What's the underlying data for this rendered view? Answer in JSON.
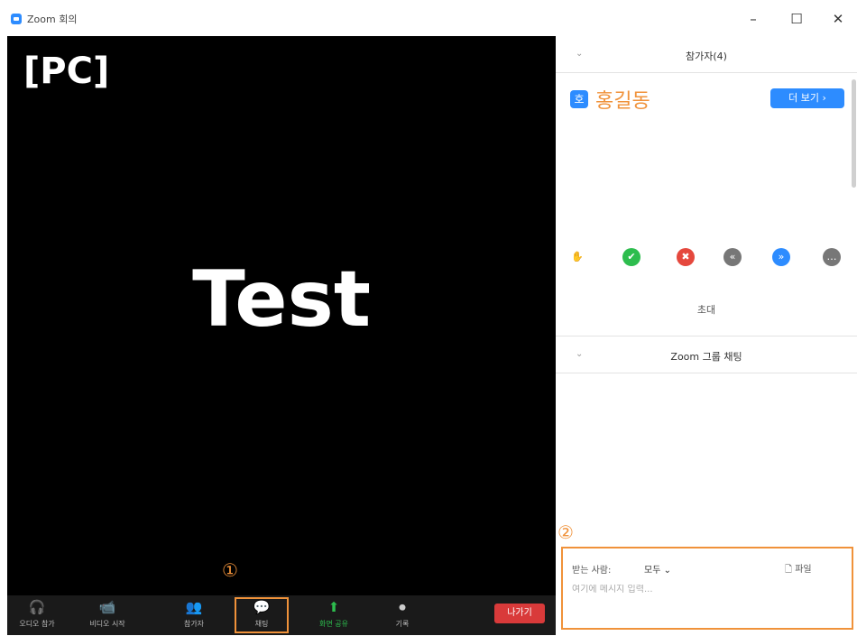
{
  "window": {
    "title": "Zoom 회의",
    "minimize": "–",
    "maximize": "☐",
    "close": "✕"
  },
  "video": {
    "corner_label": "[PC]",
    "participant_name": "Test"
  },
  "callouts": {
    "one": "①",
    "two": "②"
  },
  "toolbar": {
    "items": [
      {
        "icon": "headphones-icon",
        "glyph": "🎧",
        "label": "오디오 참가"
      },
      {
        "icon": "video-off-icon",
        "glyph": "📹",
        "label": "비디오 시작"
      },
      {
        "icon": "participants-icon",
        "glyph": "👥",
        "label": "참가자"
      },
      {
        "icon": "chat-icon",
        "glyph": "💬",
        "label": "채팅"
      },
      {
        "icon": "share-screen-icon",
        "glyph": "⬆",
        "label": "화면 공유"
      },
      {
        "icon": "record-icon",
        "glyph": "⏺",
        "label": "기록"
      }
    ],
    "leave_label": "나가기",
    "colors": {
      "share": "#2dbd4e",
      "leave": "#d93a3a"
    }
  },
  "participants_panel": {
    "title": "참가자(4)",
    "host_badge": "호",
    "host_name": "홍길동",
    "more_button": "더 보기 ›",
    "reactions": [
      {
        "icon": "raise-hand-icon",
        "glyph": "✋",
        "color": "#2d8cff"
      },
      {
        "icon": "yes-icon",
        "glyph": "✔",
        "color": "#2dbd4e"
      },
      {
        "icon": "no-icon",
        "glyph": "✖",
        "color": "#e5483d"
      },
      {
        "icon": "slower-icon",
        "glyph": "«",
        "color": "#777777"
      },
      {
        "icon": "faster-icon",
        "glyph": "»",
        "color": "#2d8cff"
      },
      {
        "icon": "more-icon",
        "glyph": "…",
        "color": "#777777"
      }
    ],
    "invite_label": "초대"
  },
  "chat_panel": {
    "title": "Zoom 그룹 채팅",
    "to_label": "받는 사람:",
    "to_value": "모두 ⌄",
    "file_label": "🗋 파일",
    "placeholder": "여기에 메시지 입력..."
  }
}
